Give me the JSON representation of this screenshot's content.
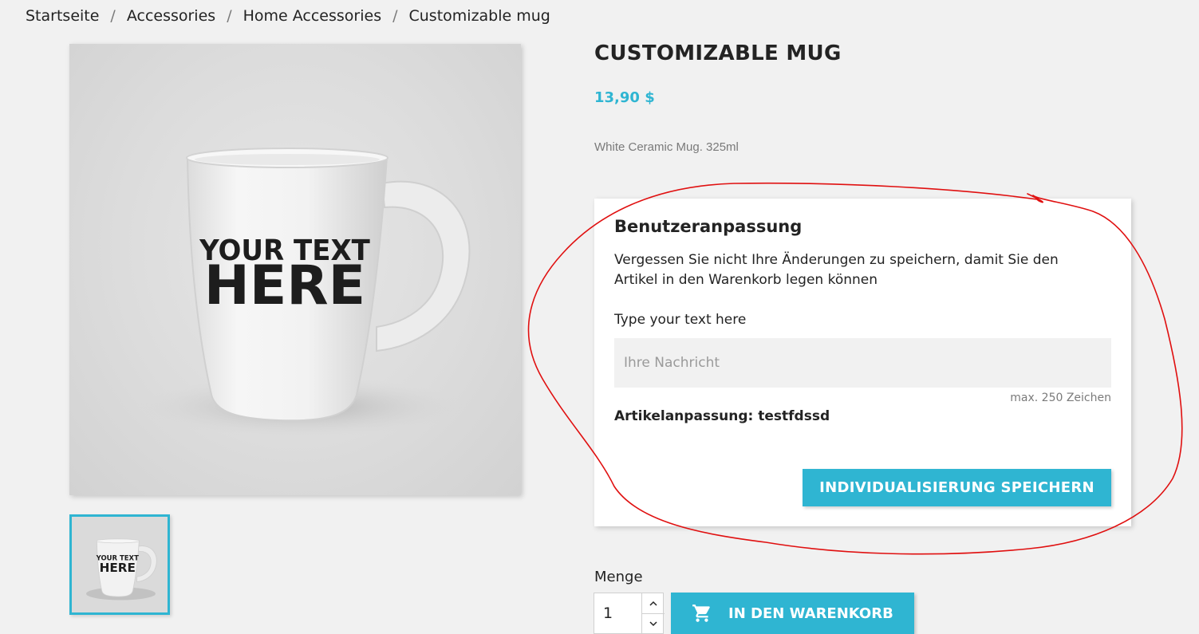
{
  "breadcrumb": {
    "items": [
      "Startseite",
      "Accessories",
      "Home Accessories",
      "Customizable mug"
    ],
    "separator": "/"
  },
  "product": {
    "title": "CUSTOMIZABLE MUG",
    "price": "13,90 $",
    "short_description": "White Ceramic Mug. 325ml",
    "image_text_line1": "YOUR TEXT",
    "image_text_line2": "HERE"
  },
  "customization": {
    "heading": "Benutzeranpassung",
    "notice": "Vergessen Sie nicht Ihre Änderungen zu speichern, damit Sie den Artikel in den Warenkorb legen können",
    "field_label": "Type your text here",
    "field_placeholder": "Ihre Nachricht",
    "field_value": "",
    "max_chars": "max. 250 Zeichen",
    "saved_label": "Artikelanpassung:",
    "saved_value": "testfdssd",
    "save_button": "INDIVIDUALISIERUNG SPEICHERN"
  },
  "purchase": {
    "quantity_label": "Menge",
    "quantity_value": "1",
    "add_to_cart": "IN DEN WARENKORB"
  },
  "colors": {
    "accent": "#2fb5d2",
    "annotation": "#e01010"
  },
  "icons": {
    "cart": "shopping-cart-icon",
    "increment": "chevron-up-icon",
    "decrement": "chevron-down-icon"
  }
}
